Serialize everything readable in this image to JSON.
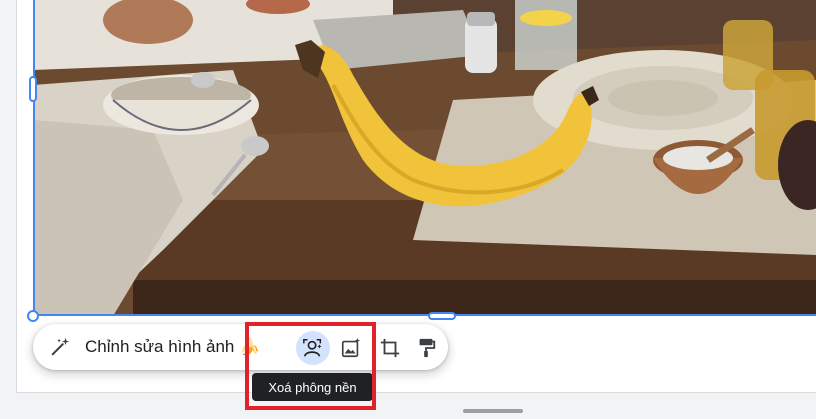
{
  "image_toolbar": {
    "edit_label": "Chỉnh sửa hình ảnh 🍌",
    "tools": [
      {
        "name": "remove-background",
        "icon": "remove-background-icon",
        "active": true
      },
      {
        "name": "image-ai-edit",
        "icon": "image-sparkle-icon",
        "active": false
      },
      {
        "name": "crop",
        "icon": "crop-icon",
        "active": false
      },
      {
        "name": "format-paint",
        "icon": "paint-roller-icon",
        "active": false
      }
    ]
  },
  "tooltip": {
    "text": "Xoá phông nền"
  },
  "colors": {
    "selection": "#4285f4",
    "active_tool_bg": "#d3e3fd",
    "tooltip_bg": "#202124",
    "highlight_box": "#e0232b"
  },
  "image": {
    "description_icon": "photo-banana-on-table"
  }
}
